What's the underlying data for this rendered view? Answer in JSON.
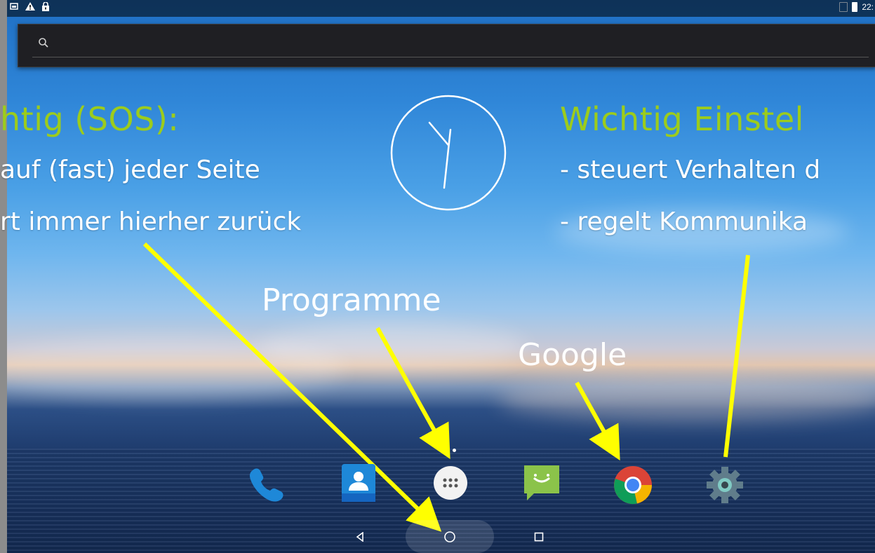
{
  "status_bar": {
    "left_icons": [
      "screenshot-icon",
      "warning-icon",
      "lock-icon"
    ],
    "time": "22:"
  },
  "search": {
    "placeholder": ""
  },
  "annotations": {
    "sos_title": "htig (SOS):",
    "sos_line1": "auf (fast) jeder Seite",
    "sos_line2": "rt immer hierher zurück",
    "settings_title": "Wichtig Einstel",
    "settings_line1": "- steuert Verhalten d",
    "settings_line2": "- regelt Kommunika",
    "programs_label": "Programme",
    "google_label": "Google"
  },
  "dock": {
    "apps": [
      "phone-icon",
      "contacts-icon",
      "app-drawer-icon",
      "messaging-icon",
      "chrome-icon",
      "settings-icon"
    ]
  },
  "nav_bar": {
    "buttons": [
      "back-icon",
      "home-icon",
      "recents-icon"
    ]
  },
  "colors": {
    "accent_yellow_green": "#9ccc1c",
    "arrow_yellow": "#ffff00",
    "searchbar_bg": "#1f1f23"
  }
}
